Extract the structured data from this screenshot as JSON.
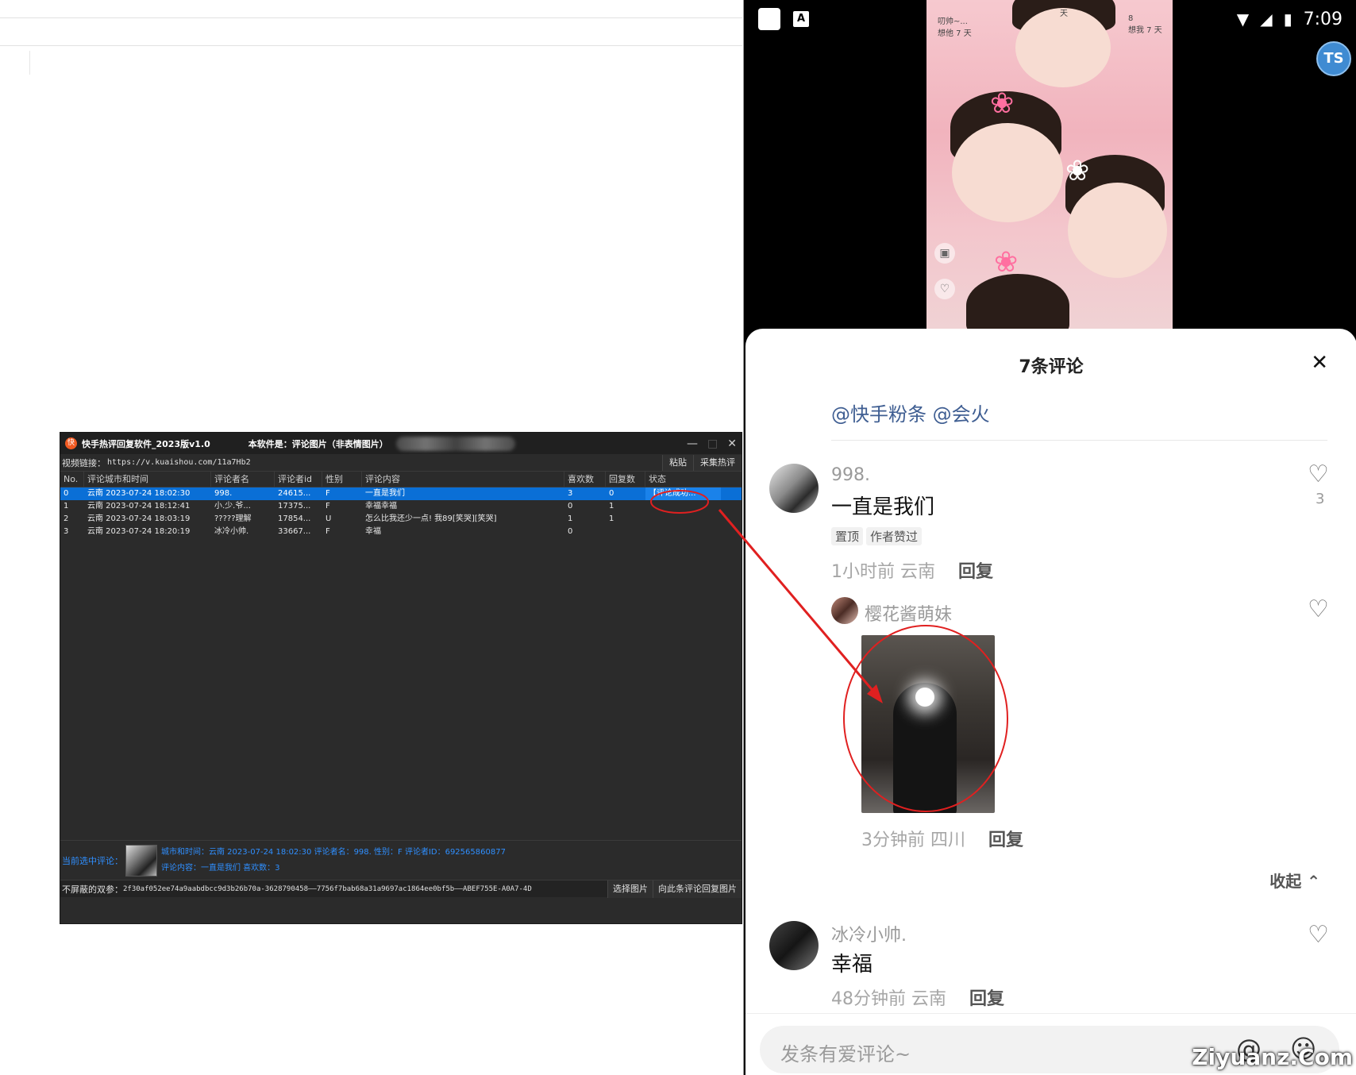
{
  "app": {
    "logo_glyph": "快",
    "title": "快手热评回复软件_2023版v1.0",
    "notice": "本软件是：评论图片（非表情图片）",
    "controls": {
      "minimize": "—",
      "maximize": "□",
      "close": "✕"
    },
    "url_label": "视频链接：",
    "url_value": "https://v.kuaishou.com/11a7Hb2",
    "paste_label": "粘贴",
    "collect_label": "采集热评",
    "columns": [
      "No.",
      "评论城市和时间",
      "评论者名",
      "评论者id",
      "性别",
      "评论内容",
      "喜欢数",
      "回复数",
      "状态"
    ],
    "rows": [
      {
        "no": "0",
        "city_time": "云南 2023-07-24 18:02:30",
        "name": "998.",
        "id": "24615...",
        "gender": "F",
        "content": "一直是我们",
        "likes": "3",
        "replies": "0",
        "status": "【评论成功..."
      },
      {
        "no": "1",
        "city_time": "云南 2023-07-24 18:12:41",
        "name": "小.少.爷...",
        "id": "17375...",
        "gender": "F",
        "content": "幸福幸福",
        "likes": "0",
        "replies": "1",
        "status": ""
      },
      {
        "no": "2",
        "city_time": "云南 2023-07-24 18:03:19",
        "name": "?????理解",
        "id": "17854...",
        "gender": "U",
        "content": "怎么比我还少一点! 我89[笑哭][笑哭]",
        "likes": "1",
        "replies": "1",
        "status": ""
      },
      {
        "no": "3",
        "city_time": "云南 2023-07-24 18:20:19",
        "name": "冰冷小帅.",
        "id": "33667...",
        "gender": "F",
        "content": "幸福",
        "likes": "0",
        "replies": "",
        "status": ""
      }
    ],
    "selected_label": "当前选中评论：",
    "selected_line1": "城市和时间：云南 2023-07-24 18:02:30 评论者名：998. 性别：F 评论者ID：692565860877",
    "selected_line2": "评论内容：一直是我们   喜欢数：3",
    "cookie_label": "不屏蔽的双参：",
    "cookie_value": "2f30af052ee74a9aabdbcc9d3b26b70a-3628790458——7756f7bab68a31a9697ac1864ee0bf5b——ABEF755E-A0A7-4D",
    "select_image_label": "选择图片",
    "reply_image_label": "向此条评论回复图片"
  },
  "phone": {
    "time": "7:09",
    "status_icons": {
      "wifi": "▼",
      "signal": "◢",
      "battery": "▮"
    },
    "video_caption_left": "叨帅~...\n想他 7 天",
    "video_caption_center": "天",
    "video_caption_right": "8\n想我 7 天",
    "ts_badge": "TS",
    "sheet_title": "7条评论",
    "close_glyph": "✕",
    "mention": "@快手粉条 @会火",
    "comments": [
      {
        "name": "998.",
        "text": "一直是我们",
        "tags": [
          "置顶",
          "作者赞过"
        ],
        "meta": "1小时前 云南",
        "reply": "回复",
        "likes": "3"
      },
      {
        "name": "樱花酱萌妹",
        "meta": "3分钟前 四川",
        "reply": "回复"
      },
      {
        "name": "冰冷小帅.",
        "text": "幸福",
        "meta": "48分钟前 云南",
        "reply": "回复"
      }
    ],
    "collapse_label": "收起 ⌃",
    "input_placeholder": "发条有爱评论~",
    "at_glyph": "@",
    "emoji_glyph": "☺",
    "heart_glyph": "♡"
  },
  "watermark": "Ziyuanz.Com",
  "colors": {
    "app_bg": "#2b2b2b",
    "selected_row": "#0a6fd6",
    "info_text": "#2f8fff",
    "annotation": "#e02020",
    "mention": "#3f5e92"
  }
}
